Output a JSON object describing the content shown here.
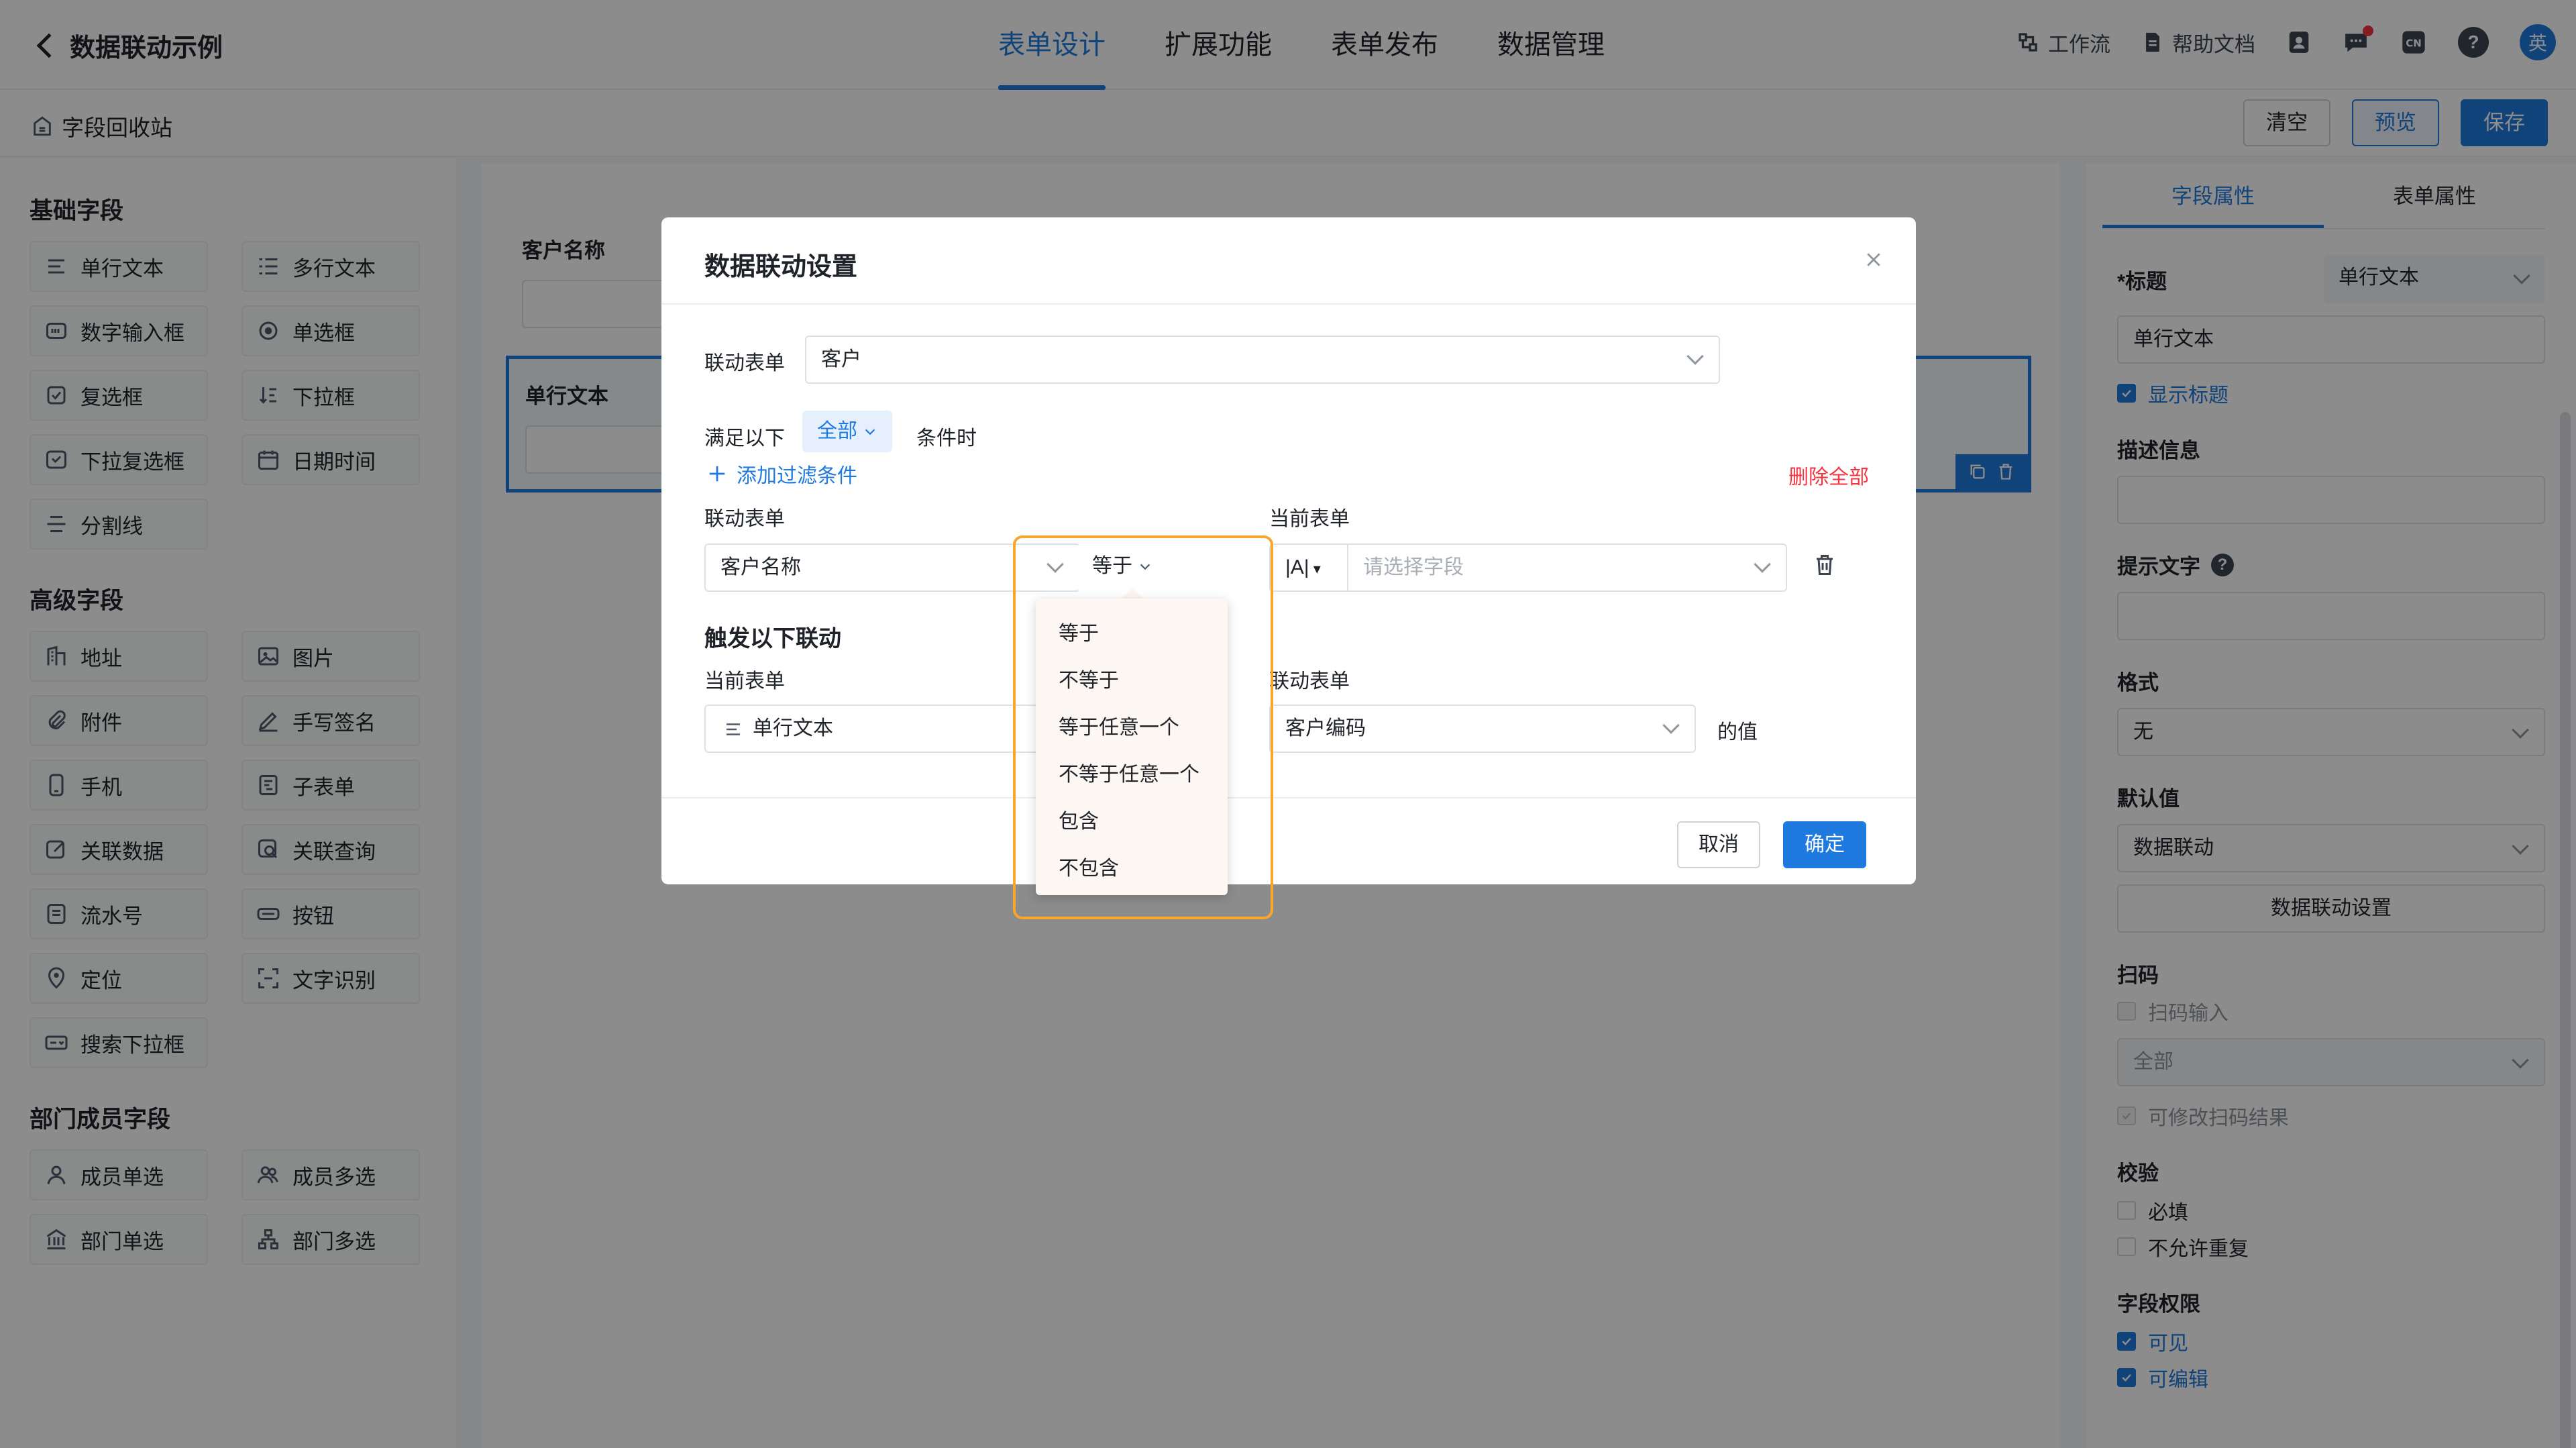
{
  "header": {
    "back_title": "数据联动示例",
    "nav_tabs": [
      "表单设计",
      "扩展功能",
      "表单发布",
      "数据管理"
    ],
    "active_tab": "表单设计",
    "workflow": "工作流",
    "help_docs": "帮助文档",
    "lang_badge": "CN",
    "help_badge": "?",
    "avatar": "英"
  },
  "toolbar": {
    "recycle": "字段回收站",
    "clear": "清空",
    "preview": "预览",
    "save": "保存"
  },
  "palette": {
    "basic_title": "基础字段",
    "basic": [
      {
        "label": "单行文本",
        "icon": "single-line-icon"
      },
      {
        "label": "多行文本",
        "icon": "multi-line-icon"
      },
      {
        "label": "数字输入框",
        "icon": "number-icon"
      },
      {
        "label": "单选框",
        "icon": "radio-icon"
      },
      {
        "label": "复选框",
        "icon": "checkbox-icon"
      },
      {
        "label": "下拉框",
        "icon": "sort-icon"
      },
      {
        "label": "下拉复选框",
        "icon": "dropdown-check-icon"
      },
      {
        "label": "日期时间",
        "icon": "calendar-icon"
      },
      {
        "label": "分割线",
        "icon": "divider-icon"
      }
    ],
    "advanced_title": "高级字段",
    "advanced": [
      {
        "label": "地址",
        "icon": "building-icon"
      },
      {
        "label": "图片",
        "icon": "image-icon"
      },
      {
        "label": "附件",
        "icon": "paperclip-icon"
      },
      {
        "label": "手写签名",
        "icon": "pen-icon"
      },
      {
        "label": "手机",
        "icon": "phone-icon"
      },
      {
        "label": "子表单",
        "icon": "subform-icon"
      },
      {
        "label": "关联数据",
        "icon": "link-edit-icon"
      },
      {
        "label": "关联查询",
        "icon": "query-icon"
      },
      {
        "label": "流水号",
        "icon": "serial-icon"
      },
      {
        "label": "按钮",
        "icon": "button-icon"
      },
      {
        "label": "定位",
        "icon": "location-icon"
      },
      {
        "label": "文字识别",
        "icon": "ocr-icon"
      },
      {
        "label": "搜索下拉框",
        "icon": "search-dropdown-icon"
      }
    ],
    "member_title": "部门成员字段",
    "member": [
      {
        "label": "成员单选",
        "icon": "user-icon"
      },
      {
        "label": "成员多选",
        "icon": "users-icon"
      },
      {
        "label": "部门单选",
        "icon": "bank-icon"
      },
      {
        "label": "部门多选",
        "icon": "org-icon"
      }
    ]
  },
  "canvas": {
    "field1_label": "客户名称",
    "field2_label": "单行文本"
  },
  "right_panel": {
    "tabs": [
      "字段属性",
      "表单属性"
    ],
    "title_label": "*标题",
    "title_type": "单行文本",
    "title_value": "单行文本",
    "show_title": "显示标题",
    "desc_label": "描述信息",
    "hint_label": "提示文字",
    "format_label": "格式",
    "format_value": "无",
    "default_label": "默认值",
    "default_value": "数据联动",
    "linkage_button": "数据联动设置",
    "scan_label": "扫码",
    "scan_input": "扫码输入",
    "scan_scope": "全部",
    "scan_modify": "可修改扫码结果",
    "validate_label": "校验",
    "required": "必填",
    "no_duplicate": "不允许重复",
    "perm_label": "字段权限",
    "visible": "可见",
    "editable": "可编辑"
  },
  "modal": {
    "title": "数据联动设置",
    "link_form_label": "联动表单",
    "link_form_value": "客户",
    "cond_prefix": "满足以下",
    "cond_scope": "全部",
    "cond_suffix": "条件时",
    "add_filter": "添加过滤条件",
    "delete_all": "删除全部",
    "col_link_form": "联动表单",
    "col_current_form": "当前表单",
    "cond_field": "客户名称",
    "operator": "等于",
    "value_type": "|A|",
    "value_placeholder": "请选择字段",
    "trigger_title": "触发以下联动",
    "trigger_current_label": "当前表单",
    "trigger_current_value": "单行文本",
    "trigger_link_label": "联动表单",
    "trigger_link_value": "客户编码",
    "trigger_suffix": "的值",
    "cancel": "取消",
    "confirm": "确定"
  },
  "operator_options": [
    "等于",
    "不等于",
    "等于任意一个",
    "不等于任意一个",
    "包含",
    "不包含"
  ],
  "colors": {
    "accent": "#1f7ae0",
    "danger": "#f5333f",
    "highlight": "#f7a72c"
  }
}
